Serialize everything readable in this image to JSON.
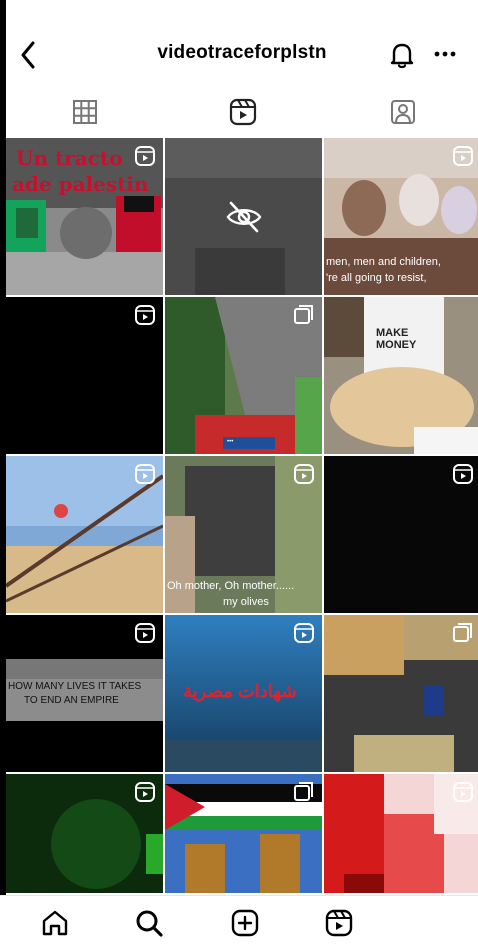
{
  "header": {
    "username": "videotraceforplstn",
    "back_icon": "chevron-left-icon",
    "notifications_icon": "bell-icon",
    "more_icon": "more-horizontal-icon"
  },
  "profile_tabs": [
    {
      "name": "posts-grid",
      "icon": "grid-icon",
      "active": false
    },
    {
      "name": "reels",
      "icon": "reels-icon",
      "active": true
    },
    {
      "name": "tagged",
      "icon": "tagged-person-icon",
      "active": false
    }
  ],
  "grid": {
    "captions": {
      "post_1_line_1": "Un tracto",
      "post_1_line_2": "ade palestin",
      "post_3_line_1": "men, men and children,",
      "post_3_line_2": "'re all going to resist,",
      "post_5_label": "•••",
      "post_6_shirt": "MAKE MONEY",
      "post_8_line_1": "Oh mother, Oh mother......",
      "post_8_line_2": "my olives",
      "post_10_line_1": "HOW MANY LIVES IT TAKES",
      "post_10_line_2": "TO END AN EMPIRE",
      "post_11_arabic": "شهادات مصرية"
    },
    "hidden_post_icon": "eye-off-icon",
    "reel_badge_icon": "reel-icon",
    "carousel_badge_icon": "multiple-posts-icon"
  },
  "bottom_nav": [
    {
      "name": "home",
      "icon": "home-icon"
    },
    {
      "name": "search",
      "icon": "search-icon"
    },
    {
      "name": "create",
      "icon": "plus-square-icon"
    },
    {
      "name": "reels",
      "icon": "reels-icon"
    }
  ],
  "colors": {
    "background": "#ffffff",
    "text": "#000000",
    "caption_red": "#c8102e"
  }
}
